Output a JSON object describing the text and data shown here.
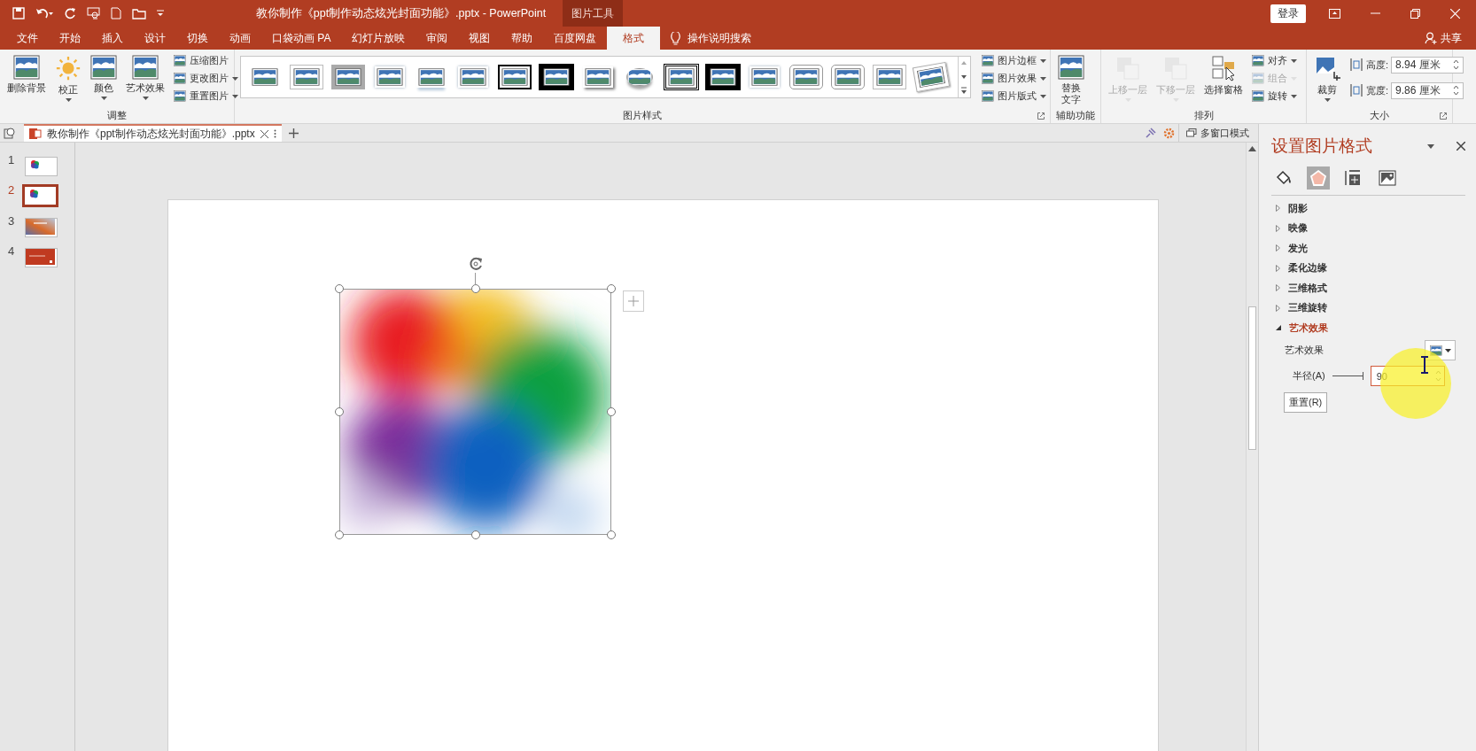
{
  "window": {
    "title": "教你制作《ppt制作动态炫光封面功能》.pptx  -  PowerPoint",
    "context_label": "图片工具",
    "sign_in": "登录"
  },
  "ribbon_tabs": [
    {
      "label": "文件",
      "selected": false
    },
    {
      "label": "开始",
      "selected": false
    },
    {
      "label": "插入",
      "selected": false
    },
    {
      "label": "设计",
      "selected": false
    },
    {
      "label": "切换",
      "selected": false
    },
    {
      "label": "动画",
      "selected": false
    },
    {
      "label": "口袋动画 PA",
      "selected": false
    },
    {
      "label": "幻灯片放映",
      "selected": false
    },
    {
      "label": "审阅",
      "selected": false
    },
    {
      "label": "视图",
      "selected": false
    },
    {
      "label": "帮助",
      "selected": false
    },
    {
      "label": "百度网盘",
      "selected": false
    },
    {
      "label": "格式",
      "selected": true
    }
  ],
  "tell_me": "操作说明搜索",
  "share": "共享",
  "ribbon_groups": [
    {
      "label": "调整",
      "launcher": false,
      "items": [
        {
          "label": "删除背景",
          "kind": "large",
          "dropdown": false,
          "disabled": false
        },
        {
          "label": "校正",
          "kind": "large",
          "dropdown": true,
          "disabled": false
        },
        {
          "label": "颜色",
          "kind": "large",
          "dropdown": true,
          "disabled": false
        },
        {
          "label": "艺术效果",
          "kind": "large",
          "dropdown": true,
          "disabled": false
        },
        {
          "label": "压缩图片",
          "kind": "small",
          "dropdown": false,
          "disabled": false
        },
        {
          "label": "更改图片",
          "kind": "small",
          "dropdown": true,
          "disabled": false
        },
        {
          "label": "重置图片",
          "kind": "small",
          "dropdown": true,
          "disabled": false
        }
      ]
    },
    {
      "label": "图片样式",
      "launcher": true,
      "items": [
        {
          "kind": "gallery",
          "disabled": false
        },
        {
          "label": "图片边框",
          "kind": "small",
          "dropdown": true,
          "disabled": false
        },
        {
          "label": "图片效果",
          "kind": "small",
          "dropdown": true,
          "disabled": false
        },
        {
          "label": "图片版式",
          "kind": "small",
          "dropdown": true,
          "disabled": false
        }
      ]
    },
    {
      "label": "辅助功能",
      "launcher": false,
      "items": [
        {
          "label": "替换文字",
          "kind": "large",
          "dropdown": false,
          "disabled": false
        }
      ]
    },
    {
      "label": "排列",
      "launcher": false,
      "items": [
        {
          "label": "上移一层",
          "kind": "large",
          "dropdown": true,
          "disabled": true
        },
        {
          "label": "下移一层",
          "kind": "large",
          "dropdown": true,
          "disabled": true
        },
        {
          "label": "选择窗格",
          "kind": "large",
          "dropdown": false,
          "disabled": false
        },
        {
          "label": "对齐",
          "kind": "small",
          "dropdown": true,
          "disabled": false
        },
        {
          "label": "组合",
          "kind": "small",
          "dropdown": true,
          "disabled": true
        },
        {
          "label": "旋转",
          "kind": "small",
          "dropdown": true,
          "disabled": false
        }
      ]
    },
    {
      "label": "大小",
      "launcher": true,
      "items": [
        {
          "label": "裁剪",
          "kind": "large",
          "dropdown": true,
          "disabled": false
        },
        {
          "label": "高度:",
          "kind": "spin",
          "value": "8.94 厘米",
          "disabled": false
        },
        {
          "label": "宽度:",
          "kind": "spin",
          "value": "9.86 厘米",
          "disabled": false
        }
      ]
    }
  ],
  "document_tab": {
    "name": "教你制作《ppt制作动态炫光封面功能》.pptx",
    "multi_window": "多窗口模式"
  },
  "slides": [
    {
      "number": "1",
      "selected": false,
      "kind": "blob"
    },
    {
      "number": "2",
      "selected": true,
      "kind": "blob"
    },
    {
      "number": "3",
      "selected": false,
      "kind": "gradient"
    },
    {
      "number": "4",
      "selected": false,
      "kind": "red"
    }
  ],
  "canvas": {
    "picture": {
      "kind": "picture",
      "selected": true
    }
  },
  "format_pane": {
    "title": "设置图片格式",
    "tabs": [
      {
        "kind": "fill",
        "selected": false
      },
      {
        "kind": "effects",
        "selected": true
      },
      {
        "kind": "size",
        "selected": false
      },
      {
        "kind": "picture",
        "selected": false
      }
    ],
    "sections": [
      {
        "label": "阴影",
        "expanded": false
      },
      {
        "label": "映像",
        "expanded": false
      },
      {
        "label": "发光",
        "expanded": false
      },
      {
        "label": "柔化边缘",
        "expanded": false
      },
      {
        "label": "三维格式",
        "expanded": false
      },
      {
        "label": "三维旋转",
        "expanded": false
      },
      {
        "label": "艺术效果",
        "expanded": true
      }
    ],
    "artistic_effect_label": "艺术效果",
    "radius": {
      "label": "半径(A)",
      "level": 1,
      "value": "90"
    },
    "reset": "重置(R)"
  }
}
